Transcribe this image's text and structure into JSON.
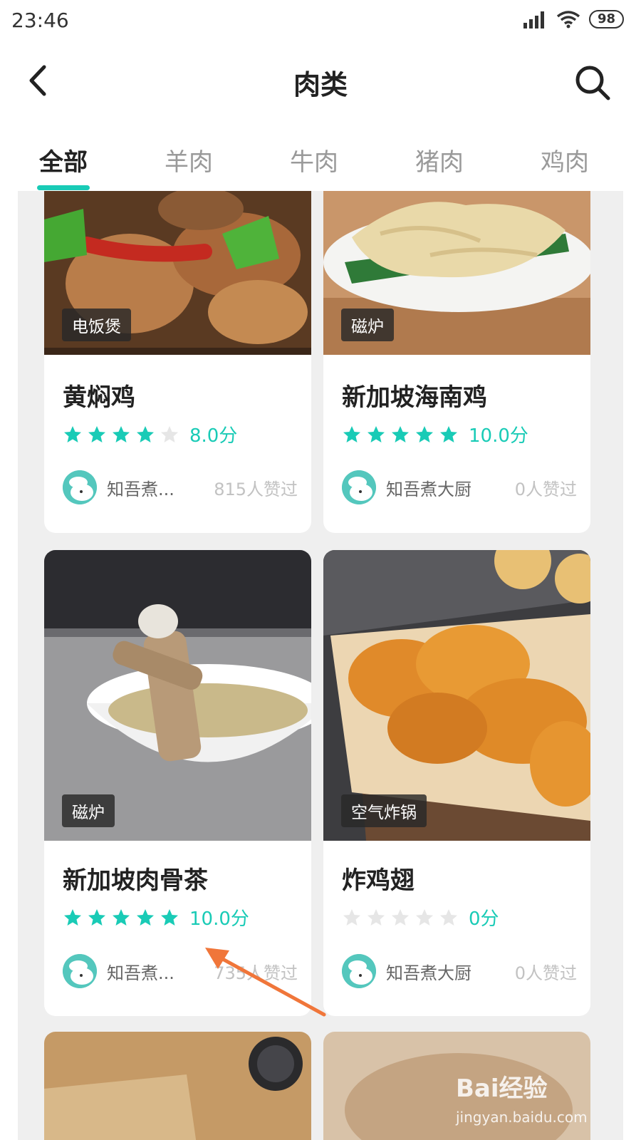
{
  "status_bar": {
    "time": "23:46",
    "battery": "98",
    "icons": [
      "signal-icon",
      "wifi-icon",
      "battery-icon"
    ]
  },
  "header": {
    "title": "肉类",
    "back_icon": "chevron-left-icon",
    "search_icon": "search-icon"
  },
  "tabs": [
    {
      "label": "全部",
      "active": true
    },
    {
      "label": "羊肉",
      "active": false
    },
    {
      "label": "牛肉",
      "active": false
    },
    {
      "label": "猪肉",
      "active": false
    },
    {
      "label": "鸡肉",
      "active": false
    }
  ],
  "recipes": [
    {
      "tag": "电饭煲",
      "title": "黄焖鸡",
      "stars_filled": 4,
      "score": "8.0分",
      "author": "知吾煮...",
      "likes": "815人赞过"
    },
    {
      "tag": "磁炉",
      "title": "新加坡海南鸡",
      "stars_filled": 5,
      "score": "10.0分",
      "author": "知吾煮大厨",
      "likes": "0人赞过"
    },
    {
      "tag": "磁炉",
      "title": "新加坡肉骨茶",
      "stars_filled": 5,
      "score": "10.0分",
      "author": "知吾煮...",
      "likes": "735人赞过"
    },
    {
      "tag": "空气炸锅",
      "title": "炸鸡翅",
      "stars_filled": 0,
      "score": "0分",
      "author": "知吾煮大厨",
      "likes": "0人赞过"
    }
  ],
  "watermark": {
    "logo": "Bai经验",
    "url": "jingyan.baidu.com"
  },
  "colors": {
    "accent": "#19cbb6",
    "star_empty": "#e6e6e6",
    "arrow": "#f0763a"
  }
}
